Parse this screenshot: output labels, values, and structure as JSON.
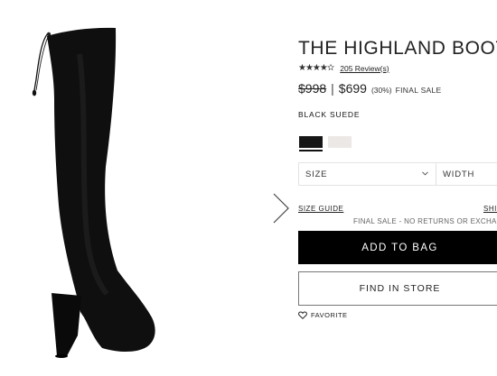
{
  "product": {
    "title": "THE HIGHLAND BOOT",
    "rating_stars": "★★★★✫",
    "reviews_link": "205 Review(s)",
    "original_price": "$998",
    "price_separator": "|",
    "sale_price": "$699",
    "discount": "(30%)",
    "final_sale_badge": "FINAL SALE",
    "color_name": "BLACK SUEDE"
  },
  "swatches": [
    {
      "color": "#161616",
      "selected": true
    },
    {
      "color": "#ece8e6",
      "selected": false
    }
  ],
  "selectors": {
    "size_label": "SIZE",
    "width_label": "WIDTH"
  },
  "links": {
    "size_guide": "SIZE GUIDE",
    "shipping": "SHIPPING"
  },
  "notes": {
    "final_sale_note": "FINAL SALE - NO RETURNS OR EXCHANGES"
  },
  "buttons": {
    "add_to_bag": "ADD TO BAG",
    "find_in_store": "FIND IN STORE",
    "favorite": "FAVORITE"
  },
  "icons": {
    "next": "chevron-right-icon",
    "dropdown": "chevron-down-icon",
    "favorite": "heart-outline-icon"
  }
}
